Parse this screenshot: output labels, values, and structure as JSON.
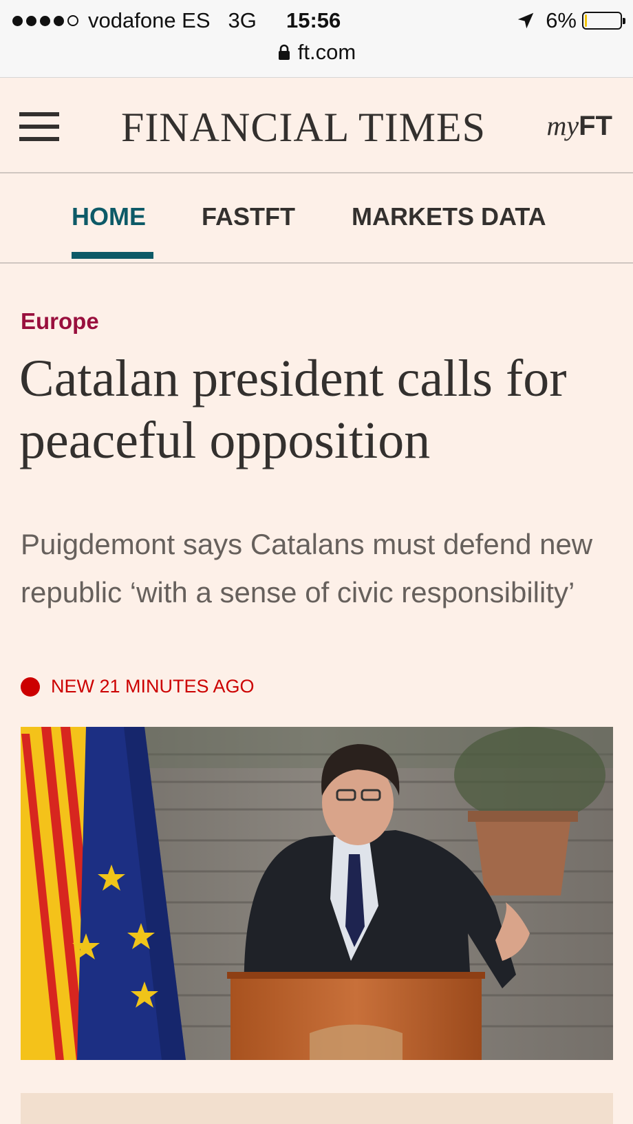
{
  "status_bar": {
    "carrier": "vodafone ES",
    "network": "3G",
    "time": "15:56",
    "battery_percent": "6%",
    "battery_level": 0.06
  },
  "browser": {
    "url": "ft.com"
  },
  "header": {
    "masthead": "FINANCIAL TIMES",
    "myft_prefix": "my",
    "myft_suffix": "FT"
  },
  "nav": {
    "items": [
      {
        "label": "HOME",
        "active": true
      },
      {
        "label": "FASTFT",
        "active": false
      },
      {
        "label": "MARKETS DATA",
        "active": false
      }
    ]
  },
  "article": {
    "section": "Europe",
    "headline": "Catalan president calls for peaceful opposition",
    "standfirst": "Puigdemont says Catalans must defend new republic ‘with a sense of civic responsibility’",
    "timestamp": "NEW 21 MINUTES AGO"
  },
  "colors": {
    "page_bg": "#fdf0e8",
    "brand_teal": "#0d5a67",
    "section_claret": "#990f3d",
    "live_red": "#cc0000",
    "text_dark": "#33302e"
  },
  "icons": {
    "menu": "hamburger-icon",
    "location": "location-arrow-icon",
    "lock": "lock-icon",
    "battery": "battery-icon",
    "live": "live-dot-icon"
  }
}
